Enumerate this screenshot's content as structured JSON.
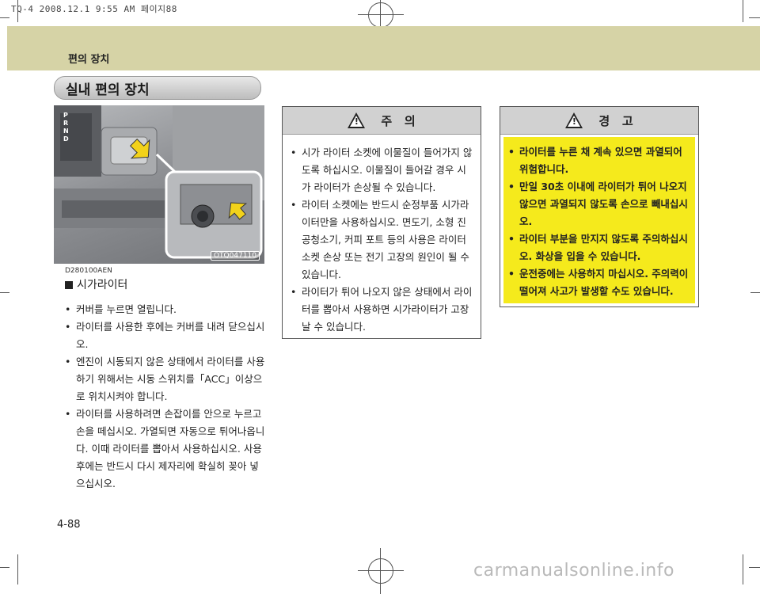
{
  "print_header": "TQ-4  2008.12.1 9:55 AM 페이지88",
  "section_title": "편의 장치",
  "topic_title": "실내 편의 장치",
  "figure": {
    "shifter_letters": "P R N D",
    "photo_code": "OTQ047110"
  },
  "reference_code": "D280100AEN",
  "subsection_title": "시가라이터",
  "left_bullets": [
    "커버를 누르면 열립니다.",
    "라이터를 사용한 후에는 커버를 내려 닫으십시오.",
    "엔진이 시동되지 않은 상태에서 라이터를 사용하기 위해서는 시동 스위치를「ACC」이상으로 위치시켜야 합니다.",
    "라이터를 사용하려면 손잡이를 안으로 누르고 손을 떼십시오. 가열되면 자동으로 튀어나옵니다. 이때 라이터를 뽑아서 사용하십시오. 사용 후에는 반드시 다시 제자리에 확실히 꽂아 넣으십시오."
  ],
  "caution": {
    "title": "주   의",
    "icon_mark": "!",
    "bullets": [
      "시가 라이터 소켓에 이물질이 들어가지 않도록 하십시오. 이물질이 들어갈 경우 시가 라이터가 손상될 수 있습니다.",
      "라이터 소켓에는 반드시 순정부품 시가라이터만을 사용하십시오. 면도기, 소형 진공청소기, 커피 포트 등의 사용은 라이터 소켓 손상 또는 전기 고장의 원인이 될 수 있습니다.",
      "라이터가 튀어 나오지 않은 상태에서 라이터를 뽑아서 사용하면 시가라이터가 고장날 수 있습니다."
    ]
  },
  "warning": {
    "title": "경   고",
    "icon_mark": "!",
    "bullets": [
      "라이터를 누른 채 계속 있으면 과열되어 위험합니다.",
      "만일 30초 이내에 라이터가 튀어 나오지 않으면 과열되지 않도록 손으로 빼내십시오.",
      "라이터 부분을 만지지 않도록 주의하십시오. 화상을 입을 수 있습니다.",
      "운전중에는 사용하지 마십시오. 주의력이 떨어져 사고가 발생할 수도 있습니다."
    ]
  },
  "page_number": "4-88",
  "watermark": "carmanualsonline.info",
  "colors": {
    "top_band": "#d6d3a6",
    "warning_yellow": "#f5ea1c",
    "box_header_gray": "#d1d1d1"
  }
}
